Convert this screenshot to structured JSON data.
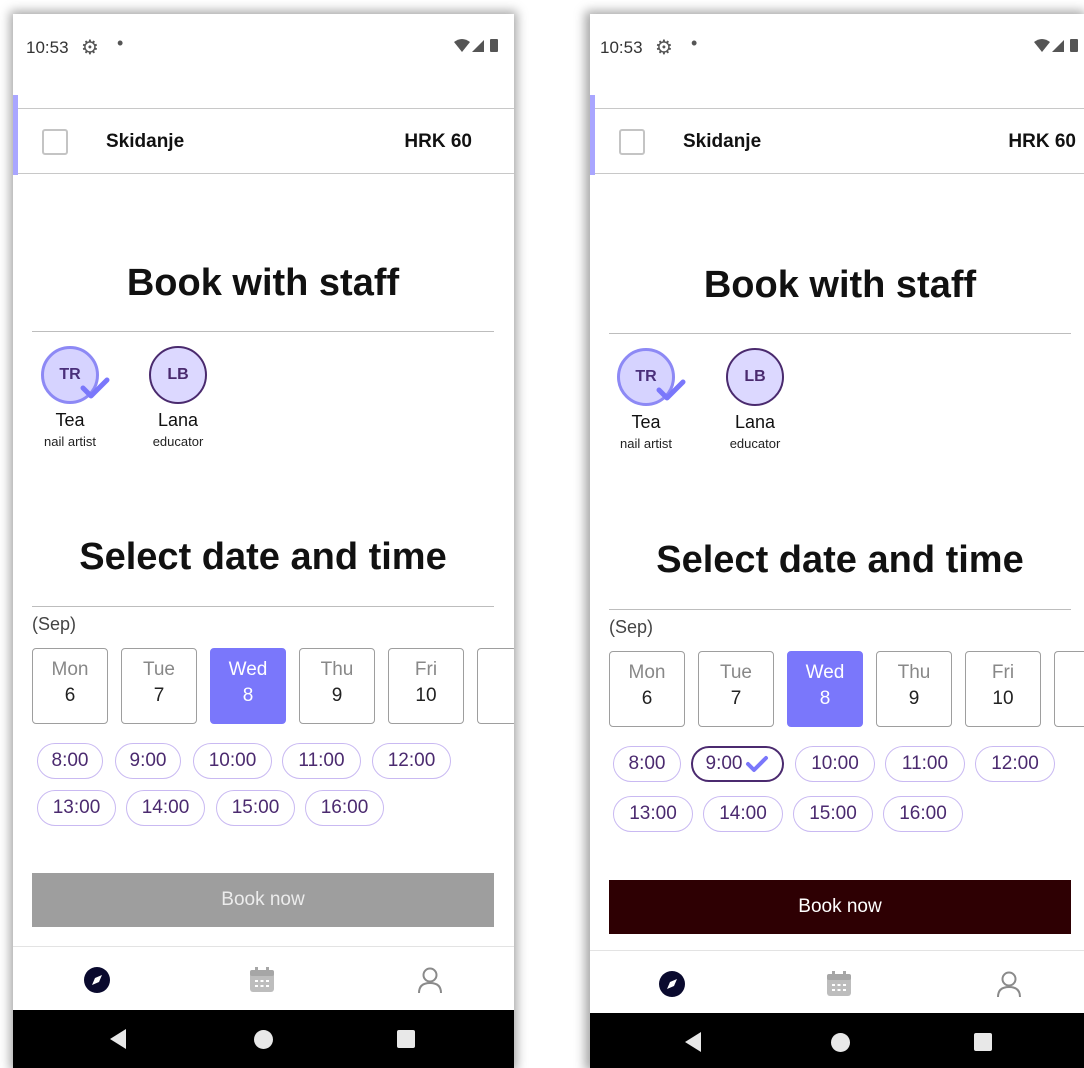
{
  "status": {
    "time": "10:53"
  },
  "service": {
    "name": "Skidanje",
    "price": "HRK 60"
  },
  "sections": {
    "staff_title": "Book with staff",
    "datetime_title": "Select date and time"
  },
  "staff": [
    {
      "initials": "TR",
      "name": "Tea",
      "role": "nail artist"
    },
    {
      "initials": "LB",
      "name": "Lana",
      "role": "educator"
    }
  ],
  "month_label": "(Sep)",
  "dates": [
    {
      "dow": "Mon",
      "day": "6"
    },
    {
      "dow": "Tue",
      "day": "7"
    },
    {
      "dow": "Wed",
      "day": "8"
    },
    {
      "dow": "Thu",
      "day": "9"
    },
    {
      "dow": "Fri",
      "day": "10"
    }
  ],
  "time_slots": [
    "8:00",
    "9:00",
    "10:00",
    "11:00",
    "12:00",
    "13:00",
    "14:00",
    "15:00",
    "16:00"
  ],
  "book_label": "Book now",
  "left_screen": {
    "selected_staff": "Tea",
    "selected_date": "8",
    "selected_slot": "",
    "book_enabled": false
  },
  "right_screen": {
    "selected_staff": "Tea",
    "selected_date": "8",
    "selected_slot": "9:00",
    "book_enabled": true
  },
  "colors": {
    "accent": "#7a77fb",
    "book_active": "#2e0003",
    "book_disabled": "#9e9e9e",
    "slot_text": "#4b2a6f"
  },
  "icons": {
    "status": [
      "gear-icon",
      "dot-icon",
      "wifi-icon",
      "signal-icon",
      "battery-icon"
    ],
    "bottom_nav": [
      "compass-icon",
      "calendar-icon",
      "person-icon"
    ],
    "android_nav": [
      "back-icon",
      "home-icon",
      "recents-icon"
    ]
  }
}
